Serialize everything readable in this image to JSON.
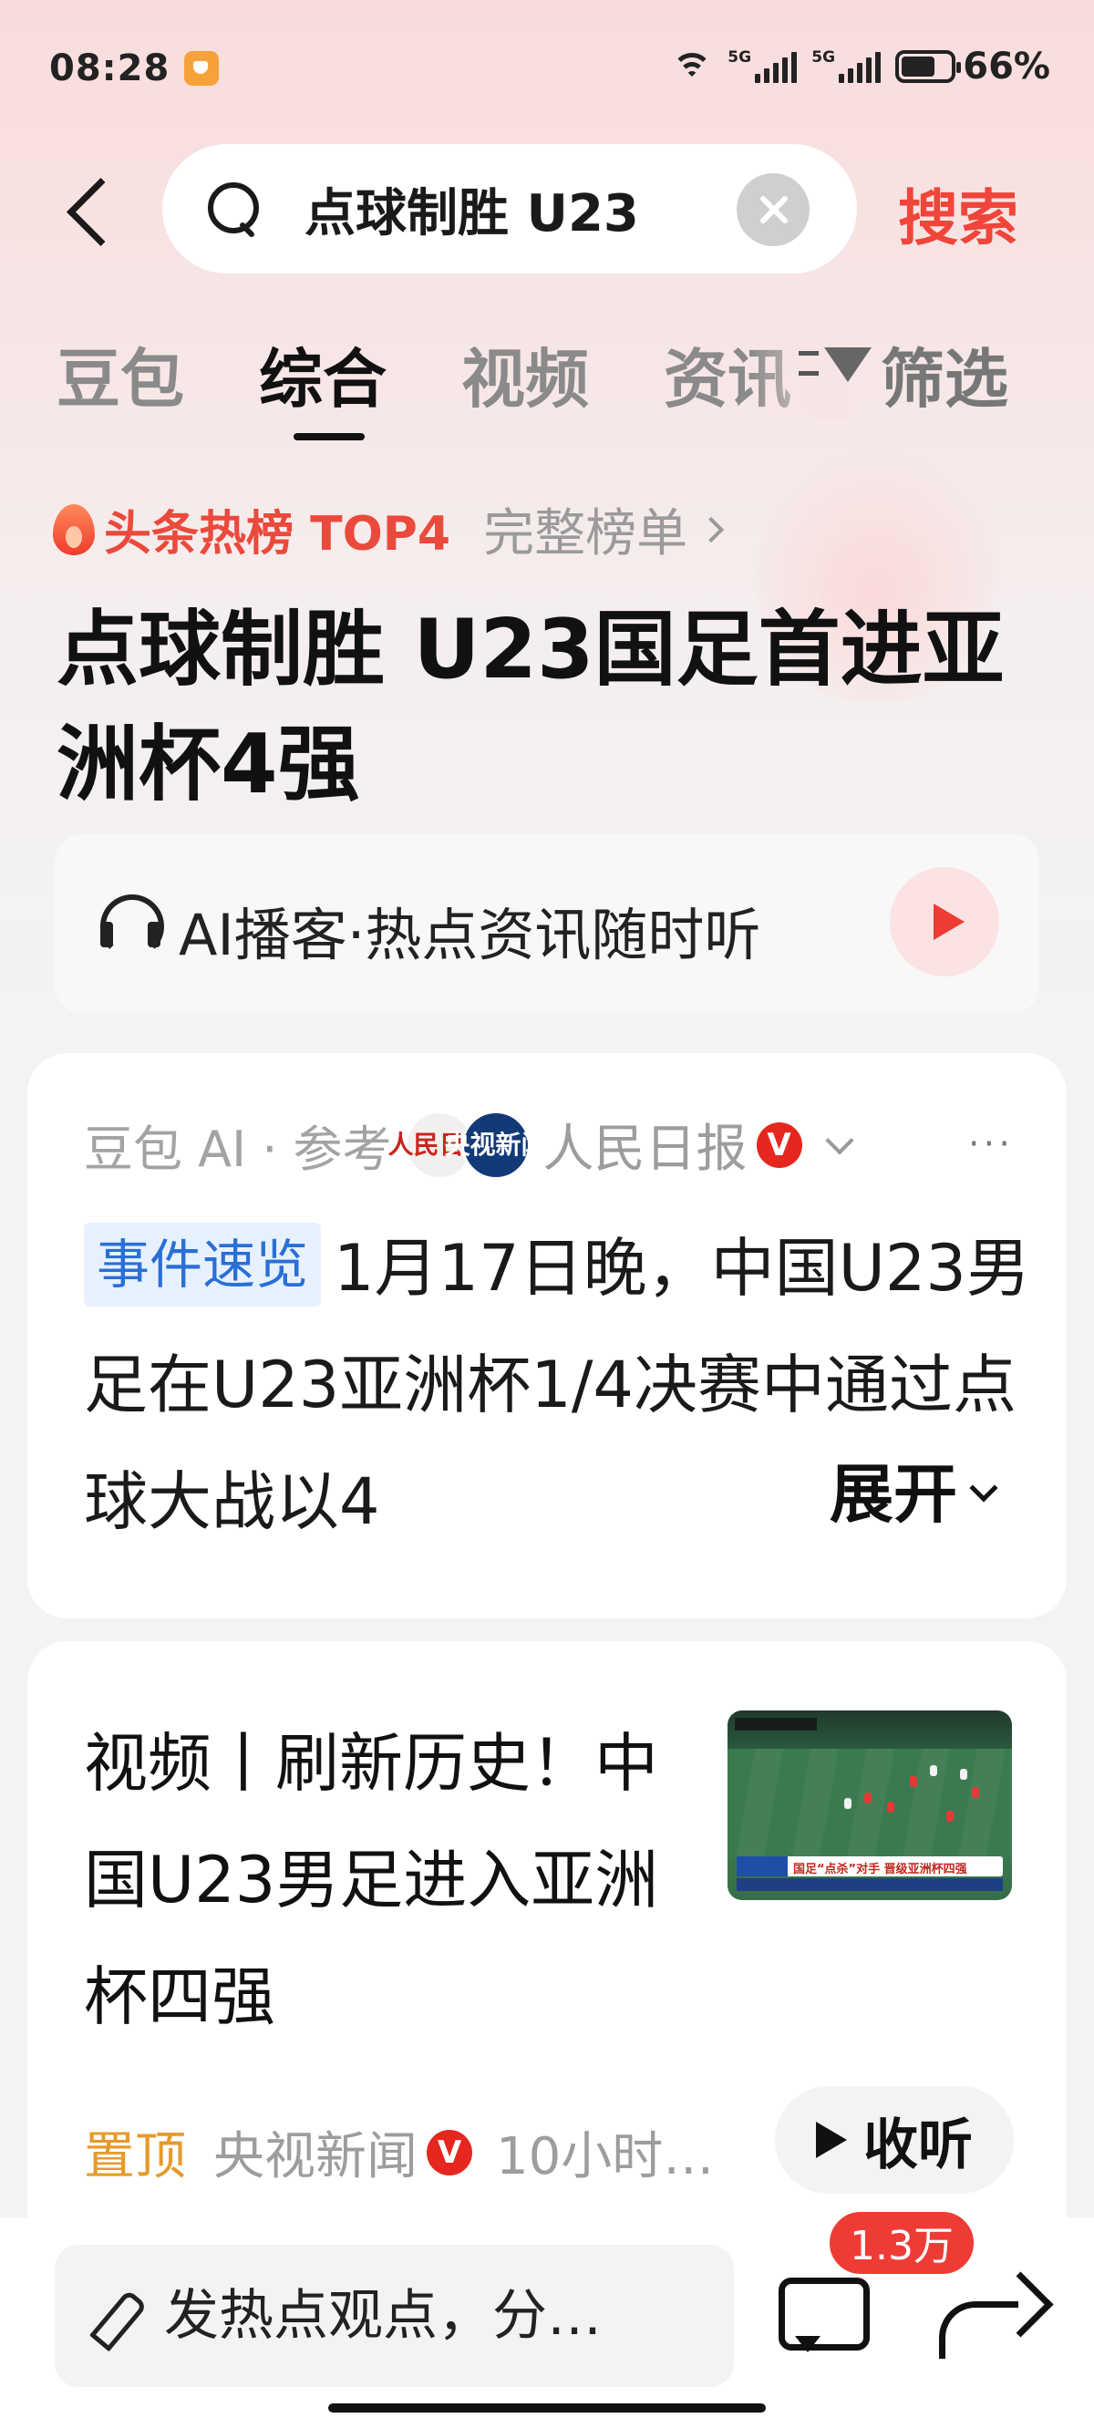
{
  "status_bar": {
    "time": "08:28",
    "net1": "5G",
    "net2": "5G",
    "battery": "66%",
    "battery_level": 0.66
  },
  "search": {
    "query": "点球制胜 U23",
    "button_label": "搜索"
  },
  "tabs": [
    {
      "label": "豆包",
      "active": false
    },
    {
      "label": "综合",
      "active": true
    },
    {
      "label": "视频",
      "active": false
    },
    {
      "label": "资讯",
      "active": false
    }
  ],
  "filter_label": "筛选",
  "hot": {
    "label": "头条热榜 TOP4",
    "full_list": "完整榜单"
  },
  "headline": "点球制胜 U23国足首进亚洲杯4强",
  "podcast": {
    "text": "AI播客·热点资讯随时听"
  },
  "ai_card": {
    "source_prefix": "豆包 AI · 参考",
    "avatar1": "人民日报",
    "avatar2": "央视新闻",
    "source_name": "人民日报",
    "verified": "V",
    "tag": "事件速览",
    "text": "1月17日晚，中国U23男足在U23亚洲杯1/4决赛中通过点球大战以4",
    "expand": "展开"
  },
  "video_card": {
    "title": "视频丨刷新历史！中国U23男足进入亚洲杯四强",
    "thumb_caption": "国足“点杀”对手 晋级亚洲杯四强",
    "pin": "置顶",
    "source": "央视新闻",
    "verified": "V",
    "time": "10小时…",
    "listen": "收听"
  },
  "bottom_bar": {
    "comment_placeholder": "发热点观点，分…",
    "comment_count": "1.3万"
  },
  "colors": {
    "accent": "#f0453a",
    "tag_bg": "#e7f1fd",
    "tag_text": "#2a6fd6",
    "pin": "#e59a2c"
  }
}
